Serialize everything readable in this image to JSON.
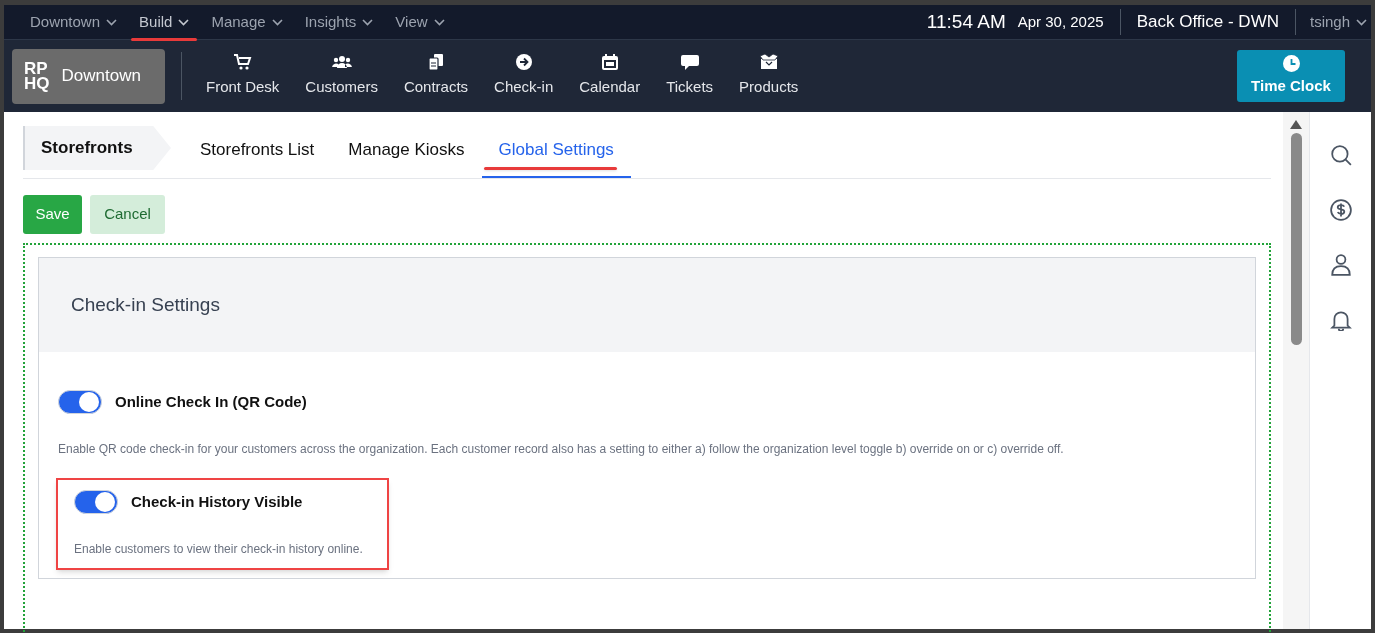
{
  "top_menu": [
    {
      "label": "Downtown",
      "selected": false
    },
    {
      "label": "Build",
      "selected": true
    },
    {
      "label": "Manage",
      "selected": false
    },
    {
      "label": "Insights",
      "selected": false
    },
    {
      "label": "View",
      "selected": false
    }
  ],
  "clock": {
    "time": "11:54 AM",
    "date": "Apr 30, 2025"
  },
  "location": "Back Office - DWN",
  "user": "tsingh",
  "logo": {
    "mark_top": "RP",
    "mark_bottom": "HQ",
    "name": "Downtown"
  },
  "nav": [
    {
      "kind": "cart",
      "label": "Front Desk"
    },
    {
      "kind": "users",
      "label": "Customers"
    },
    {
      "kind": "docs",
      "label": "Contracts"
    },
    {
      "kind": "arrow",
      "label": "Check-in"
    },
    {
      "kind": "calendar",
      "label": "Calendar"
    },
    {
      "kind": "chat",
      "label": "Tickets"
    },
    {
      "kind": "box",
      "label": "Products"
    }
  ],
  "time_clock": "Time Clock",
  "breadcrumb": "Storefronts",
  "tabs": [
    {
      "label": "Storefronts List",
      "selected": false
    },
    {
      "label": "Manage Kiosks",
      "selected": false
    },
    {
      "label": "Global Settings",
      "selected": true
    }
  ],
  "buttons": {
    "save": "Save",
    "cancel": "Cancel"
  },
  "section": {
    "title": "Check-in Settings",
    "settings": [
      {
        "label": "Online Check In (QR Code)",
        "on": true,
        "highlighted": false,
        "description": "Enable QR code check-in for your customers across the organization. Each customer record also has a setting to either a) follow the organization level toggle b) override on or c) override off."
      },
      {
        "label": "Check-in History Visible",
        "on": true,
        "highlighted": true,
        "description": "Enable customers to view their check-in history online."
      }
    ]
  },
  "side_icons": [
    {
      "kind": "search"
    },
    {
      "kind": "dollar"
    },
    {
      "kind": "user"
    },
    {
      "kind": "bell"
    }
  ]
}
